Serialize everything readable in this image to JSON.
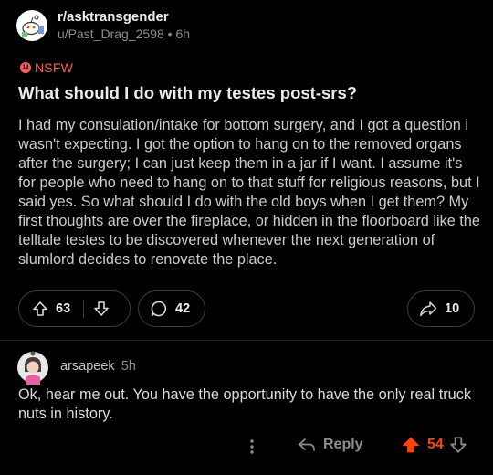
{
  "post": {
    "subreddit": "r/asktransgender",
    "author": "u/Past_Drag_2598",
    "separator": "•",
    "age": "6h",
    "nsfw_label": "NSFW",
    "nsfw_badge_text": "18",
    "title": "What should I do with my testes post-srs?",
    "body": "I had my consulation/intake for bottom surgery, and I got a question i wasn't expecting. I got the option to hang on to the removed organs after the surgery; I can just keep them in a jar if I want. I assume it's for people who need to hang on to that stuff for religious reasons, but I said yes. So what should I do with the old boys when I get them? My first thoughts are over the fireplace, or hidden in the floorboard like the telltale testes to be discovered whenever the next generation of slumlord decides to renovate the place.",
    "votes": "63",
    "comments": "42",
    "shares": "10"
  },
  "comment": {
    "author": "arsapeek",
    "age": "5h",
    "text": "Ok, hear me out. You have the opportunity to have the only real truck nuts in history.",
    "reply_label": "Reply",
    "votes": "54"
  },
  "colors": {
    "background": "#000000",
    "nsfw": "#ff5a56",
    "upvote_active": "#ff4500",
    "muted": "#8a8d90",
    "border": "#3a3c3e"
  },
  "icons": [
    "snoo-avatar",
    "nsfw-icon",
    "upvote-icon",
    "downvote-icon",
    "comment-icon",
    "share-icon",
    "user-avatar",
    "more-icon",
    "reply-icon"
  ]
}
